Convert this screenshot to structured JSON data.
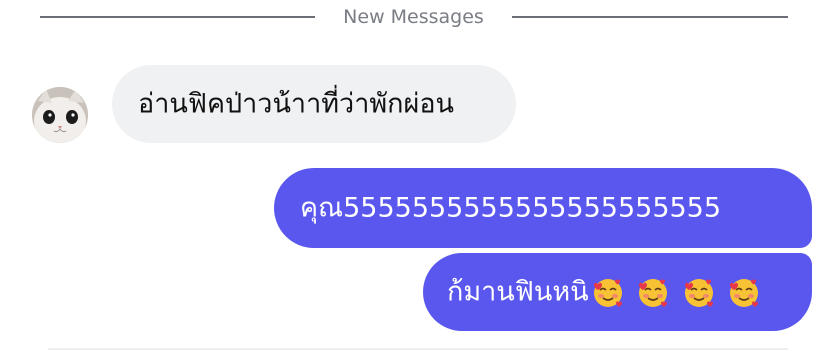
{
  "divider": {
    "label": "New Messages"
  },
  "messages": [
    {
      "direction": "incoming",
      "sender_avatar": "cat-avatar",
      "text": "อ่านฟิคป่าวน้าาที่ว่าพักผ่อน"
    },
    {
      "direction": "outgoing",
      "text": "คุณ5555555555555555555555"
    },
    {
      "direction": "outgoing",
      "text": "ก้มานฟินหนิ",
      "emojis": [
        "smiling-face-with-hearts",
        "smiling-face-with-hearts",
        "smiling-face-with-hearts",
        "smiling-face-with-hearts"
      ]
    }
  ],
  "colors": {
    "outgoing_bubble": "#5a57ee",
    "incoming_bubble": "#f0f1f3",
    "divider_text": "#7a7d85",
    "divider_line": "#6b6e76"
  }
}
